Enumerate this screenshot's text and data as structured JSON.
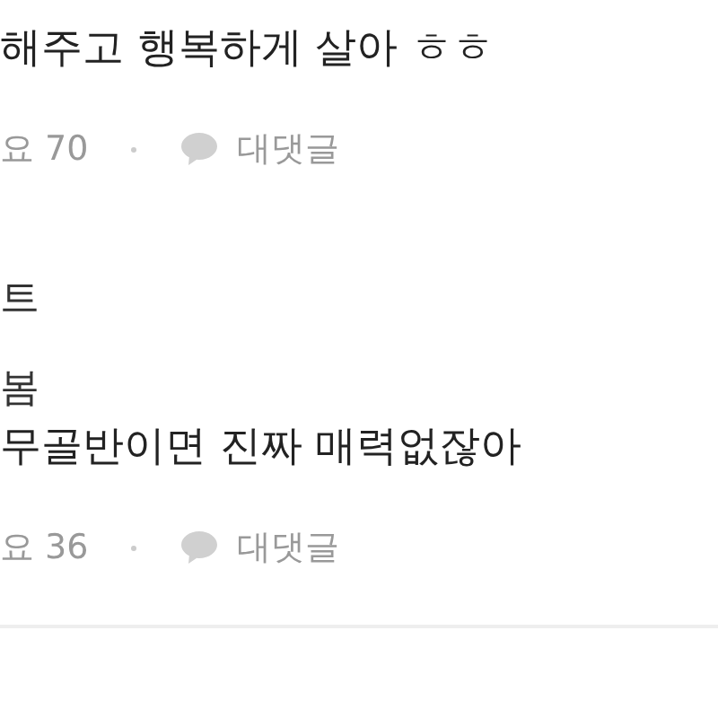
{
  "comments": [
    {
      "body_tail": "해주고 행복하게 살아 ㅎㅎ",
      "likes": "요 70",
      "reply": "대댓글"
    },
    {
      "author_tail": "트",
      "body_tail": "무골반이면 진짜 매력없잖아",
      "likes": "요 36",
      "reply": "대댓글",
      "sub_author": "봄"
    }
  ]
}
